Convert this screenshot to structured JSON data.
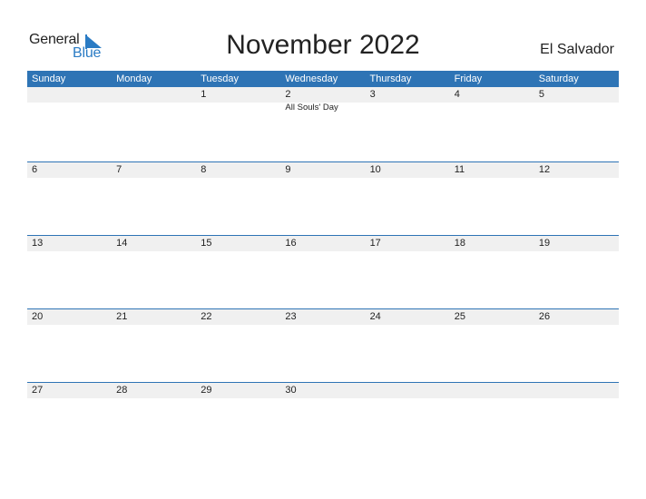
{
  "logo": {
    "word1": "General",
    "word2": "Blue"
  },
  "title": "November 2022",
  "country": "El Salvador",
  "colors": {
    "accent": "#2e74b5",
    "row_band": "#f0f0f0"
  },
  "weekdays": [
    "Sunday",
    "Monday",
    "Tuesday",
    "Wednesday",
    "Thursday",
    "Friday",
    "Saturday"
  ],
  "weeks": [
    [
      "",
      "",
      "1",
      "2",
      "3",
      "4",
      "5"
    ],
    [
      "6",
      "7",
      "8",
      "9",
      "10",
      "11",
      "12"
    ],
    [
      "13",
      "14",
      "15",
      "16",
      "17",
      "18",
      "19"
    ],
    [
      "20",
      "21",
      "22",
      "23",
      "24",
      "25",
      "26"
    ],
    [
      "27",
      "28",
      "29",
      "30",
      "",
      "",
      ""
    ]
  ],
  "events": [
    {
      "week": 0,
      "day": 3,
      "label": "All Souls' Day"
    }
  ]
}
